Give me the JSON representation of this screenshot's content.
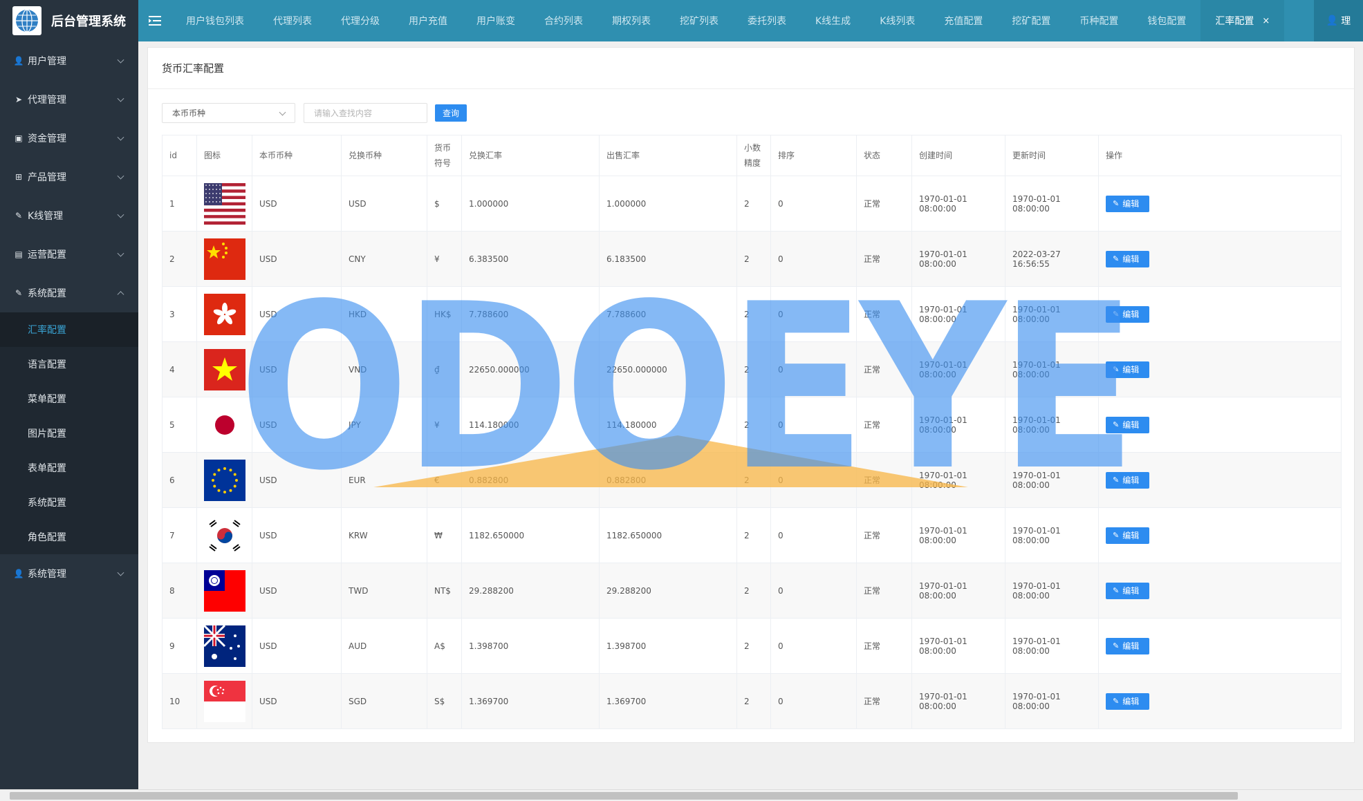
{
  "app": {
    "title": "后台管理系统"
  },
  "sidebar": {
    "groups": [
      {
        "label": "用户管理",
        "icon": "user-icon"
      },
      {
        "label": "代理管理",
        "icon": "send-icon"
      },
      {
        "label": "资金管理",
        "icon": "briefcase-icon"
      },
      {
        "label": "产品管理",
        "icon": "sitemap-icon"
      },
      {
        "label": "K线管理",
        "icon": "wrench-icon"
      },
      {
        "label": "运营配置",
        "icon": "document-icon"
      },
      {
        "label": "系统配置",
        "icon": "wrench-icon"
      }
    ],
    "sub_items": [
      "汇率配置",
      "语言配置",
      "菜单配置",
      "图片配置",
      "表单配置",
      "系统配置",
      "角色配置"
    ],
    "last_group": {
      "label": "系统管理",
      "icon": "user-lock-icon"
    }
  },
  "topbar": {
    "tabs": [
      "用户钱包列表",
      "代理列表",
      "代理分级",
      "用户充值",
      "用户账变",
      "合约列表",
      "期权列表",
      "挖矿列表",
      "委托列表",
      "K线生成",
      "K线列表",
      "充值配置",
      "挖矿配置",
      "币种配置",
      "钱包配置"
    ],
    "active_tab": "汇率配置",
    "close_glyph": "×",
    "user_label": "理"
  },
  "panel": {
    "title": "货币汇率配置"
  },
  "filters": {
    "select_value": "本币币种",
    "search_placeholder": "请输入查找内容",
    "query_label": "查询"
  },
  "table": {
    "headers": {
      "id": "id",
      "icon": "图标",
      "base": "本币币种",
      "target": "兑换币种",
      "symbol_1": "货币",
      "symbol_2": "符号",
      "rate": "兑换汇率",
      "sell": "出售汇率",
      "prec_1": "小数",
      "prec_2": "精度",
      "sort": "排序",
      "status": "状态",
      "created": "创建时间",
      "updated": "更新时间",
      "ops": "操作"
    },
    "edit_label": "编辑",
    "rows": [
      {
        "id": "1",
        "flag": "us",
        "base": "USD",
        "target": "USD",
        "symbol": "$",
        "rate": "1.000000",
        "sell": "1.000000",
        "prec": "2",
        "sort": "0",
        "status": "正常",
        "created": "1970-01-01 08:00:00",
        "updated": "1970-01-01 08:00:00"
      },
      {
        "id": "2",
        "flag": "cn",
        "base": "USD",
        "target": "CNY",
        "symbol": "¥",
        "rate": "6.383500",
        "sell": "6.183500",
        "prec": "2",
        "sort": "0",
        "status": "正常",
        "created": "1970-01-01 08:00:00",
        "updated": "2022-03-27 16:56:55"
      },
      {
        "id": "3",
        "flag": "hk",
        "base": "USD",
        "target": "HKD",
        "symbol": "HK$",
        "rate": "7.788600",
        "sell": "7.788600",
        "prec": "2",
        "sort": "0",
        "status": "正常",
        "created": "1970-01-01 08:00:00",
        "updated": "1970-01-01 08:00:00"
      },
      {
        "id": "4",
        "flag": "vn",
        "base": "USD",
        "target": "VND",
        "symbol": "₫",
        "rate": "22650.000000",
        "sell": "22650.000000",
        "prec": "2",
        "sort": "0",
        "status": "正常",
        "created": "1970-01-01 08:00:00",
        "updated": "1970-01-01 08:00:00"
      },
      {
        "id": "5",
        "flag": "jp",
        "base": "USD",
        "target": "JPY",
        "symbol": "¥",
        "rate": "114.180000",
        "sell": "114.180000",
        "prec": "2",
        "sort": "0",
        "status": "正常",
        "created": "1970-01-01 08:00:00",
        "updated": "1970-01-01 08:00:00"
      },
      {
        "id": "6",
        "flag": "eu",
        "base": "USD",
        "target": "EUR",
        "symbol": "€",
        "rate": "0.882800",
        "sell": "0.882800",
        "prec": "2",
        "sort": "0",
        "status": "正常",
        "created": "1970-01-01 08:00:00",
        "updated": "1970-01-01 08:00:00"
      },
      {
        "id": "7",
        "flag": "kr",
        "base": "USD",
        "target": "KRW",
        "symbol": "₩",
        "rate": "1182.650000",
        "sell": "1182.650000",
        "prec": "2",
        "sort": "0",
        "status": "正常",
        "created": "1970-01-01 08:00:00",
        "updated": "1970-01-01 08:00:00"
      },
      {
        "id": "8",
        "flag": "tw",
        "base": "USD",
        "target": "TWD",
        "symbol": "NT$",
        "rate": "29.288200",
        "sell": "29.288200",
        "prec": "2",
        "sort": "0",
        "status": "正常",
        "created": "1970-01-01 08:00:00",
        "updated": "1970-01-01 08:00:00"
      },
      {
        "id": "9",
        "flag": "au",
        "base": "USD",
        "target": "AUD",
        "symbol": "A$",
        "rate": "1.398700",
        "sell": "1.398700",
        "prec": "2",
        "sort": "0",
        "status": "正常",
        "created": "1970-01-01 08:00:00",
        "updated": "1970-01-01 08:00:00"
      },
      {
        "id": "10",
        "flag": "sg",
        "base": "USD",
        "target": "SGD",
        "symbol": "S$",
        "rate": "1.369700",
        "sell": "1.369700",
        "prec": "2",
        "sort": "0",
        "status": "正常",
        "created": "1970-01-01 08:00:00",
        "updated": "1970-01-01 08:00:00"
      }
    ]
  },
  "watermark": {
    "text": "ODOEYE"
  },
  "colors": {
    "sidebar": "#28333e",
    "topbar": "#2f8fb0",
    "accent": "#2d8cf0",
    "status_ok": "#5fb878",
    "active_sub": "#39a3d3"
  }
}
